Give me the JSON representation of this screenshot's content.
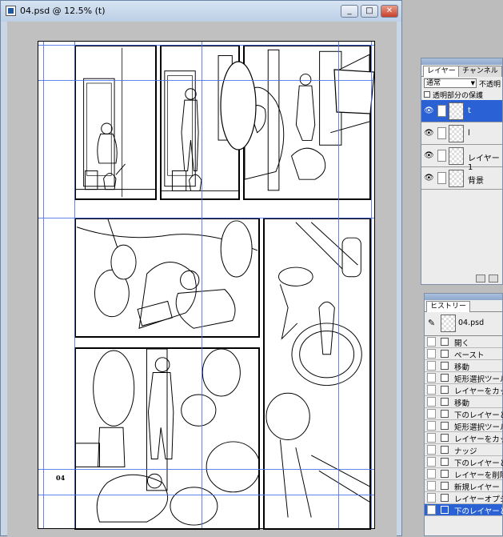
{
  "window": {
    "title": "04.psd @ 12.5% (t)",
    "buttons": {
      "minimize": "_",
      "maximize": "□",
      "close": "✕"
    }
  },
  "document": {
    "page_number": "04"
  },
  "layers_palette": {
    "tabs": [
      "レイヤー",
      "チャンネル"
    ],
    "blend_mode": "通常",
    "opacity_label": "不透明",
    "lock_label": "透明部分の保護",
    "layers": [
      {
        "name": "t",
        "visible": true,
        "selected": true,
        "icon": "brush-icon"
      },
      {
        "name": "l",
        "visible": true,
        "selected": false,
        "icon": ""
      },
      {
        "name": "レイヤー 1",
        "visible": true,
        "selected": false,
        "icon": ""
      },
      {
        "name": "背景",
        "visible": true,
        "selected": false,
        "icon": ""
      }
    ]
  },
  "history_palette": {
    "tab": "ヒストリー",
    "snapshot": "04.psd",
    "items": [
      "開く",
      "ペースト",
      "移動",
      "矩形選択ツール",
      "レイヤーをカット",
      "移動",
      "下のレイヤーと",
      "矩形選択ツール",
      "レイヤーをカット",
      "ナッジ",
      "下のレイヤーと",
      "レイヤーを削除",
      "新規レイヤー",
      "レイヤーオプシ",
      "下のレイヤーと"
    ]
  },
  "colors": {
    "guide": "#4a6ee8",
    "selection": "#2a62d6"
  }
}
